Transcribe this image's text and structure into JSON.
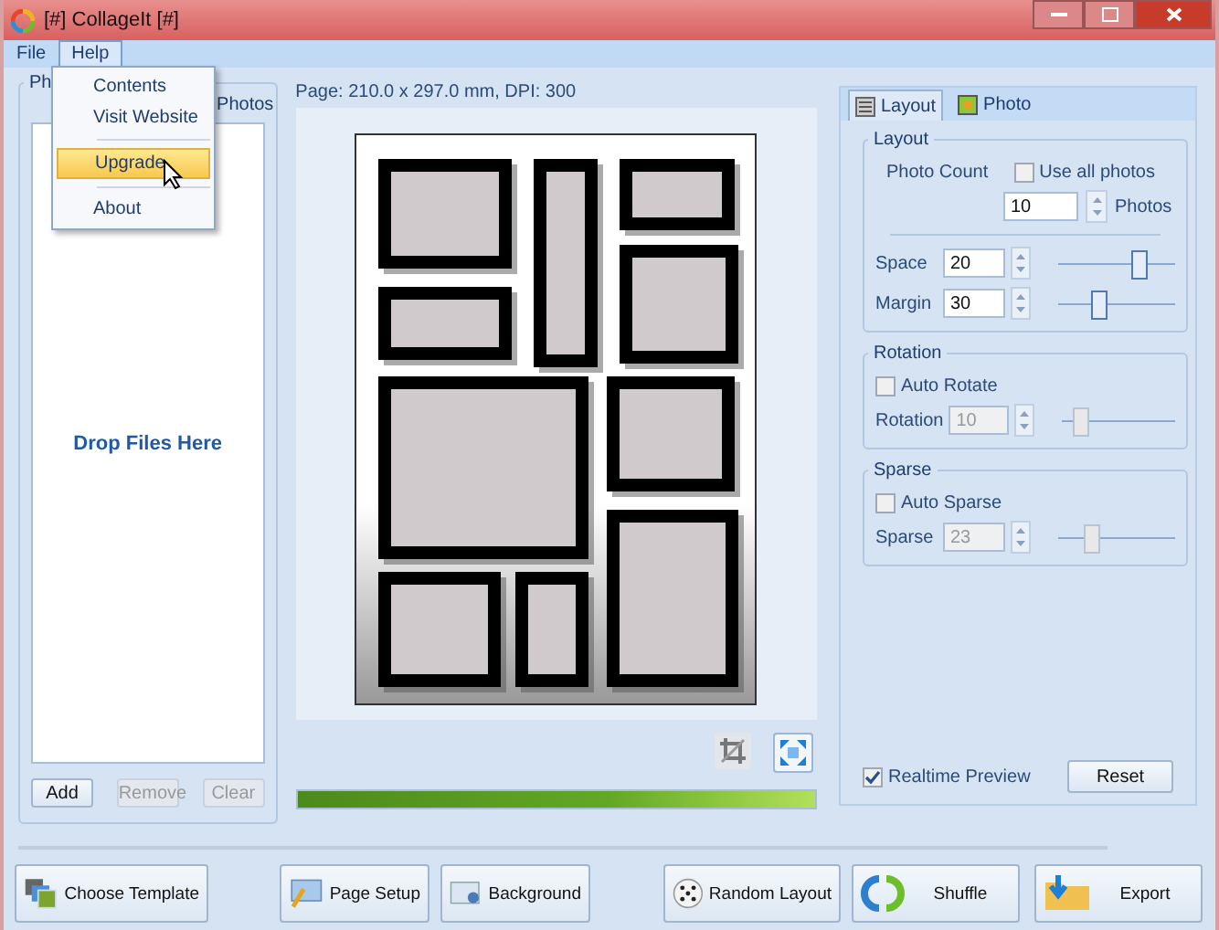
{
  "window": {
    "title": "[#] CollageIt [#]"
  },
  "menu_bar": [
    {
      "label": "File",
      "selected": false
    },
    {
      "label": "Help",
      "selected": true
    }
  ],
  "help_menu": [
    {
      "label": "Contents",
      "selected": false
    },
    {
      "label": "Visit Website",
      "selected": false
    },
    {
      "label": "Upgrade",
      "selected": true
    },
    {
      "label": "About",
      "selected": false
    }
  ],
  "photos_panel": {
    "group_label": "Ph",
    "tab_label": "Photos",
    "drop_hint": "Drop Files Here",
    "buttons": [
      {
        "label": "Add",
        "disabled": false
      },
      {
        "label": "Remove",
        "disabled": true
      },
      {
        "label": "Clear",
        "disabled": true
      }
    ]
  },
  "preview": {
    "page_info": "Page: 210.0 x 297.0 mm, DPI: 300",
    "progress": {
      "level": 1.0
    }
  },
  "settings_tabs": [
    {
      "label": "Layout",
      "selected": true
    },
    {
      "label": "Photo",
      "selected": false
    }
  ],
  "layout_group": {
    "title": "Layout",
    "photo_count_label": "Photo Count",
    "use_all_photos": {
      "label": "Use all photos",
      "checked": false
    },
    "photo_count": "10",
    "photos_unit": "Photos",
    "sliders": [
      {
        "label": "Space",
        "value": "20",
        "level": 0.69,
        "disabled": false
      },
      {
        "label": "Margin",
        "value": "30",
        "level": 0.36,
        "disabled": false
      }
    ]
  },
  "rotation_group": {
    "title": "Rotation",
    "auto": {
      "label": "Auto Rotate",
      "checked": false
    },
    "slider": {
      "label": "Rotation",
      "value": "10",
      "level": 0.17,
      "disabled": true
    }
  },
  "sparse_group": {
    "title": "Sparse",
    "auto": {
      "label": "Auto Sparse",
      "checked": false
    },
    "slider": {
      "label": "Sparse",
      "value": "23",
      "level": 0.29,
      "disabled": true
    }
  },
  "realtime_preview": {
    "label": "Realtime Preview",
    "checked": true
  },
  "reset_button": "Reset",
  "bottom_buttons": [
    "Choose Template",
    "Page Setup",
    "Background",
    "Random Layout",
    "Shuffle",
    "Export"
  ]
}
